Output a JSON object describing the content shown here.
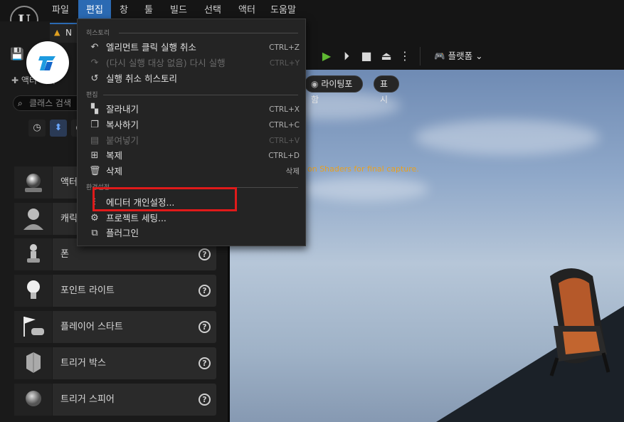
{
  "menubar": {
    "logo": "U",
    "items": [
      "파일",
      "편집",
      "창",
      "툴",
      "빌드",
      "선택",
      "액터",
      "도움말"
    ],
    "active_index": 1
  },
  "tab": {
    "label": "N"
  },
  "left_panel": {
    "header": "액터 배치",
    "search_placeholder": "클래스 검색",
    "items": [
      {
        "label": "액터",
        "icon": "sphere-icon"
      },
      {
        "label": "캐릭",
        "icon": "character-icon"
      },
      {
        "label": "폰",
        "icon": "pawn-icon"
      },
      {
        "label": "포인트 라이트",
        "icon": "light-bulb-icon"
      },
      {
        "label": "플레이어 스타트",
        "icon": "player-start-icon"
      },
      {
        "label": "트리거 박스",
        "icon": "trigger-box-icon"
      },
      {
        "label": "트리거 스피어",
        "icon": "trigger-sphere-icon"
      }
    ],
    "help_glyph": "?"
  },
  "toolbar": {
    "platform_label": "플랫폼"
  },
  "viewport": {
    "pills": [
      "라이팅포함",
      "표시"
    ],
    "message": "on Shaders for final capture."
  },
  "edit_menu": {
    "sections": [
      {
        "header": "히스토리",
        "items": [
          {
            "label": "엘리먼트 클릭 실행 취소",
            "shortcut": "CTRL+Z",
            "icon": "undo-icon",
            "disabled": false
          },
          {
            "label": "(다시 실행 대상 없음) 다시 실행",
            "shortcut": "CTRL+Y",
            "icon": "redo-icon",
            "disabled": true
          },
          {
            "label": "실행 취소 히스토리",
            "shortcut": "",
            "icon": "history-icon",
            "disabled": false
          }
        ]
      },
      {
        "header": "편집",
        "items": [
          {
            "label": "잘라내기",
            "shortcut": "CTRL+X",
            "icon": "cut-icon",
            "disabled": false
          },
          {
            "label": "복사하기",
            "shortcut": "CTRL+C",
            "icon": "copy-icon",
            "disabled": false
          },
          {
            "label": "붙여넣기",
            "shortcut": "CTRL+V",
            "icon": "paste-icon",
            "disabled": true
          },
          {
            "label": "복제",
            "shortcut": "CTRL+D",
            "icon": "duplicate-icon",
            "disabled": false
          },
          {
            "label": "삭제",
            "shortcut": "삭제",
            "icon": "trash-icon",
            "disabled": false
          }
        ]
      },
      {
        "header": "환경설정",
        "items": [
          {
            "label": "에디터 개인설정...",
            "shortcut": "",
            "icon": "sliders-icon",
            "disabled": false
          },
          {
            "label": "프로젝트 세팅...",
            "shortcut": "",
            "icon": "project-settings-icon",
            "disabled": false
          },
          {
            "label": "플러그인",
            "shortcut": "",
            "icon": "plugin-icon",
            "disabled": false
          }
        ]
      }
    ]
  },
  "colors": {
    "accent": "#2b6ab3",
    "highlight": "#e01a1a",
    "play": "#5fb832"
  }
}
